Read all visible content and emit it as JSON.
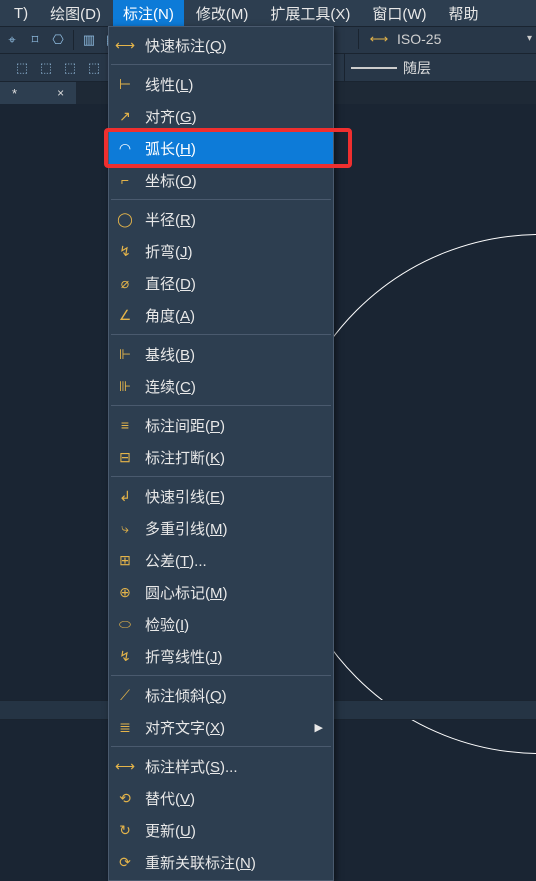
{
  "menubar": {
    "items": [
      {
        "label": "T)"
      },
      {
        "label": "绘图(D)"
      },
      {
        "label": "标注(N)"
      },
      {
        "label": "修改(M)"
      },
      {
        "label": "扩展工具(X)"
      },
      {
        "label": "窗口(W)"
      },
      {
        "label": "帮助"
      }
    ],
    "active_index": 2
  },
  "dimstyle": {
    "value": "ISO-25"
  },
  "layer_linetype": {
    "value": "随层"
  },
  "tab": {
    "label": "*",
    "close": "×"
  },
  "dropdown": {
    "items": [
      {
        "type": "item",
        "icon": "quick-dim-icon",
        "label_pre": "快速标注(",
        "hot": "Q",
        "label_post": ")"
      },
      {
        "type": "sep"
      },
      {
        "type": "item",
        "icon": "linear-dim-icon",
        "label_pre": "线性(",
        "hot": "L",
        "label_post": ")"
      },
      {
        "type": "item",
        "icon": "aligned-dim-icon",
        "label_pre": "对齐(",
        "hot": "G",
        "label_post": ")"
      },
      {
        "type": "item",
        "icon": "arc-length-icon",
        "label_pre": "弧长(",
        "hot": "H",
        "label_post": ")",
        "selected": true
      },
      {
        "type": "item",
        "icon": "ordinate-dim-icon",
        "label_pre": "坐标(",
        "hot": "O",
        "label_post": ")"
      },
      {
        "type": "sep"
      },
      {
        "type": "item",
        "icon": "radius-dim-icon",
        "label_pre": "半径(",
        "hot": "R",
        "label_post": ")"
      },
      {
        "type": "item",
        "icon": "jogged-dim-icon",
        "label_pre": "折弯(",
        "hot": "J",
        "label_post": ")"
      },
      {
        "type": "item",
        "icon": "diameter-dim-icon",
        "label_pre": "直径(",
        "hot": "D",
        "label_post": ")"
      },
      {
        "type": "item",
        "icon": "angular-dim-icon",
        "label_pre": "角度(",
        "hot": "A",
        "label_post": ")"
      },
      {
        "type": "sep"
      },
      {
        "type": "item",
        "icon": "baseline-dim-icon",
        "label_pre": "基线(",
        "hot": "B",
        "label_post": ")"
      },
      {
        "type": "item",
        "icon": "continue-dim-icon",
        "label_pre": "连续(",
        "hot": "C",
        "label_post": ")"
      },
      {
        "type": "sep"
      },
      {
        "type": "item",
        "icon": "dim-space-icon",
        "label_pre": "标注间距(",
        "hot": "P",
        "label_post": ")"
      },
      {
        "type": "item",
        "icon": "dim-break-icon",
        "label_pre": "标注打断(",
        "hot": "K",
        "label_post": ")"
      },
      {
        "type": "sep"
      },
      {
        "type": "item",
        "icon": "quick-leader-icon",
        "label_pre": "快速引线(",
        "hot": "E",
        "label_post": ")"
      },
      {
        "type": "item",
        "icon": "mleader-icon",
        "label_pre": "多重引线(",
        "hot": "M",
        "label_post": ")"
      },
      {
        "type": "item",
        "icon": "tolerance-icon",
        "label_pre": "公差(",
        "hot": "T",
        "label_post": ")..."
      },
      {
        "type": "item",
        "icon": "center-mark-icon",
        "label_pre": "圆心标记(",
        "hot": "M",
        "label_post": ")"
      },
      {
        "type": "item",
        "icon": "inspect-icon",
        "label_pre": "检验(",
        "hot": "I",
        "label_post": ")"
      },
      {
        "type": "item",
        "icon": "jogged-linear-icon",
        "label_pre": "折弯线性(",
        "hot": "J",
        "label_post": ")"
      },
      {
        "type": "sep"
      },
      {
        "type": "item",
        "icon": "oblique-icon",
        "label_pre": "标注倾斜(",
        "hot": "Q",
        "label_post": ")"
      },
      {
        "type": "item",
        "icon": "align-text-icon",
        "label_pre": "对齐文字(",
        "hot": "X",
        "label_post": ")",
        "submenu": true
      },
      {
        "type": "sep"
      },
      {
        "type": "item",
        "icon": "dim-style-icon",
        "label_pre": "标注样式(",
        "hot": "S",
        "label_post": ")..."
      },
      {
        "type": "item",
        "icon": "override-icon",
        "label_pre": "替代(",
        "hot": "V",
        "label_post": ")"
      },
      {
        "type": "item",
        "icon": "update-icon",
        "label_pre": "更新(",
        "hot": "U",
        "label_post": ")"
      },
      {
        "type": "item",
        "icon": "reassoc-icon",
        "label_pre": "重新关联标注(",
        "hot": "N",
        "label_post": ")"
      }
    ]
  }
}
